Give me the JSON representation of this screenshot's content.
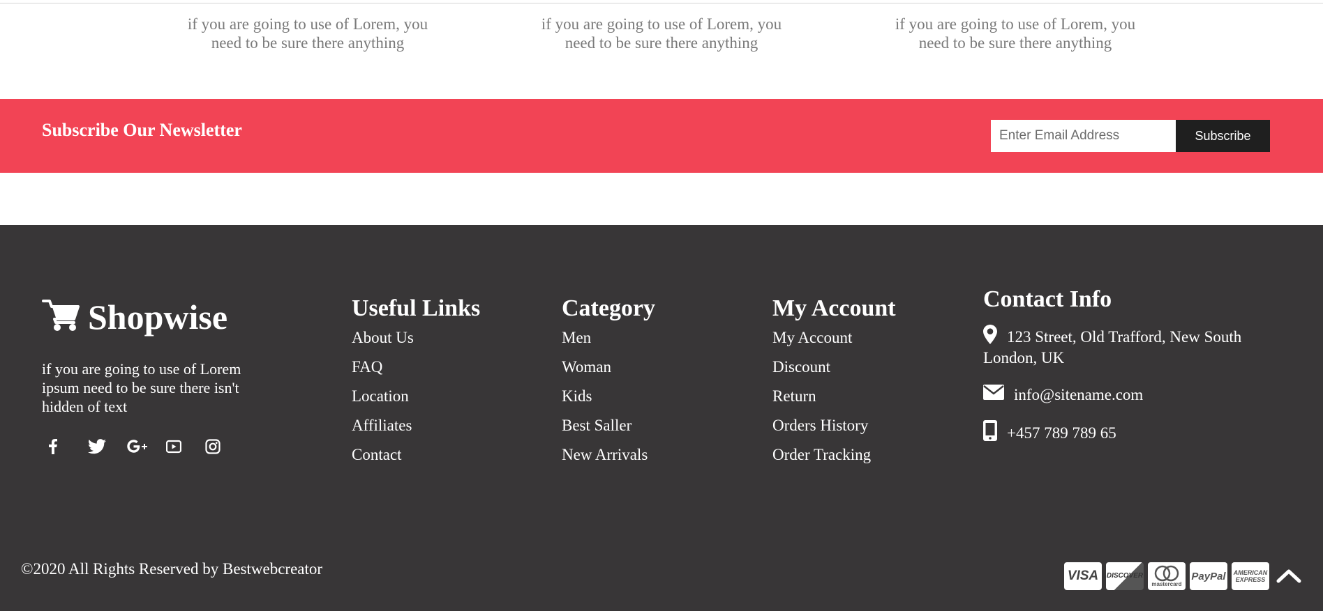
{
  "features": [
    {
      "description": "if you are going to use of Lorem, you need to be sure there anything"
    },
    {
      "description": "if you are going to use of Lorem, you need to be sure there anything"
    },
    {
      "description": "if you are going to use of Lorem, you need to be sure there anything"
    }
  ],
  "newsletter": {
    "title": "Subscribe Our Newsletter",
    "email_placeholder": "Enter Email Address",
    "button_label": "Subscribe",
    "background_color": "#f24455"
  },
  "footer": {
    "background_color": "#383637",
    "brand": {
      "icon": "shopping-cart-icon",
      "name": "Shopwise",
      "description": "if you are going to use of Lorem ipsum need to be sure there isn't hidden of text"
    },
    "socials": [
      {
        "icon": "facebook-icon"
      },
      {
        "icon": "twitter-icon"
      },
      {
        "icon": "google-plus-icon"
      },
      {
        "icon": "youtube-icon"
      },
      {
        "icon": "instagram-icon"
      }
    ],
    "useful_links": {
      "title": "Useful Links",
      "items": [
        "About Us",
        "FAQ",
        "Location",
        "Affiliates",
        "Contact"
      ]
    },
    "category": {
      "title": "Category",
      "items": [
        "Men",
        "Woman",
        "Kids",
        "Best Saller",
        "New Arrivals"
      ]
    },
    "my_account": {
      "title": "My Account",
      "items": [
        "My Account",
        "Discount",
        "Return",
        "Orders History",
        "Order Tracking"
      ]
    },
    "contact": {
      "title": "Contact Info",
      "address": "123 Street, Old Trafford, New South London, UK",
      "email": "info@sitename.com",
      "phone": "+457 789 789 65"
    },
    "copyright": "©2020 All Rights Reserved by Bestwebcreator",
    "payments": [
      {
        "label": "VISA",
        "icon": "visa-card-icon"
      },
      {
        "label": "DISCOVER",
        "icon": "discover-card-icon"
      },
      {
        "label": "mastercard",
        "icon": "mastercard-card-icon"
      },
      {
        "label": "PayPal",
        "icon": "paypal-card-icon"
      },
      {
        "label": "AMERICAN EXPRESS",
        "icon": "amex-card-icon"
      }
    ],
    "scroll_top_icon": "chevron-up-icon"
  }
}
